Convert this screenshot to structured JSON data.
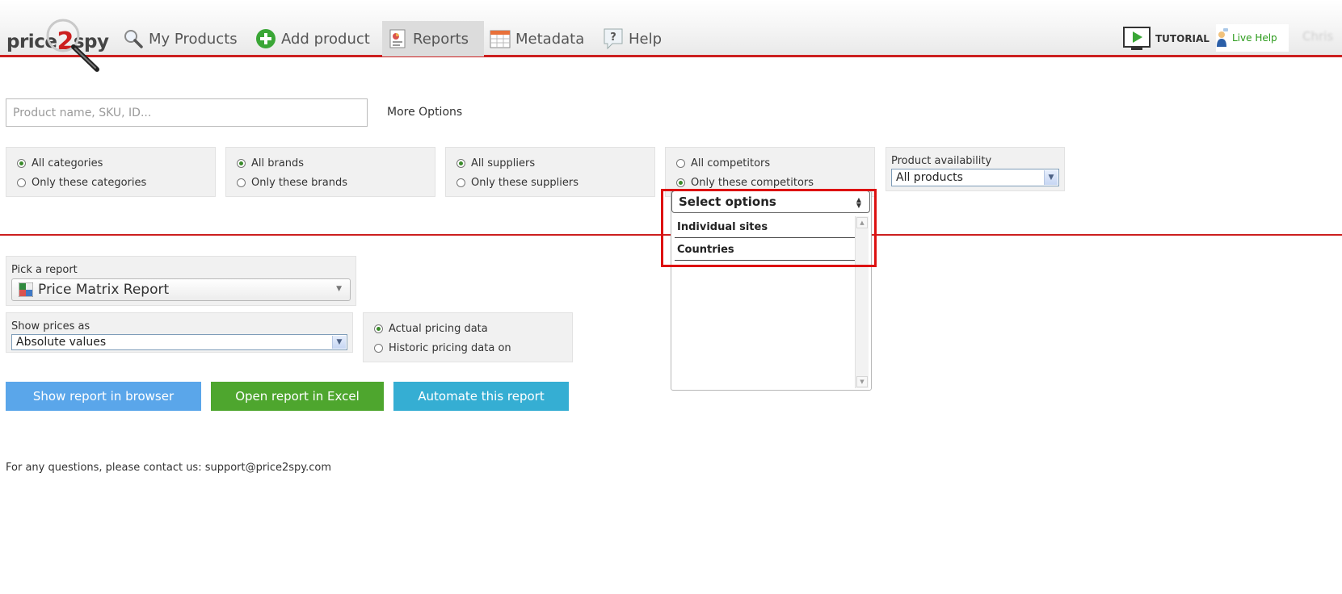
{
  "brand": {
    "logo_text_a": "price",
    "logo_text_b": "2",
    "logo_text_c": "spy",
    "accent": "#cc1f1f"
  },
  "nav": {
    "items": [
      {
        "label": "My Products",
        "icon": "magnifier-icon"
      },
      {
        "label": "Add product",
        "icon": "plus-circle-icon"
      },
      {
        "label": "Reports",
        "icon": "report-icon",
        "active": true
      },
      {
        "label": "Metadata",
        "icon": "calendar-table-icon"
      },
      {
        "label": "Help",
        "icon": "question-icon"
      }
    ],
    "tutorial_label": "TUTORIAL",
    "live_help_label": "Live Help",
    "user_name": "Chris"
  },
  "search": {
    "placeholder": "Product name, SKU, ID...",
    "value": "",
    "more_options": "More Options"
  },
  "filters": {
    "categories": {
      "all": "All categories",
      "only": "Only these categories",
      "selected": "all"
    },
    "brands": {
      "all": "All brands",
      "only": "Only these brands",
      "selected": "all"
    },
    "suppliers": {
      "all": "All suppliers",
      "only": "Only these suppliers",
      "selected": "all"
    },
    "competitors": {
      "all": "All competitors",
      "only": "Only these competitors",
      "selected": "only"
    },
    "availability": {
      "label": "Product availability",
      "value": "All products"
    }
  },
  "competitor_dropdown": {
    "placeholder": "Select options",
    "options": [
      "Individual sites",
      "Countries"
    ]
  },
  "report": {
    "pick_label": "Pick a report",
    "selected": "Price Matrix Report",
    "show_prices_label": "Show prices as",
    "show_prices_value": "Absolute values",
    "pricing_actual": "Actual pricing data",
    "pricing_historic": "Historic pricing data on",
    "pricing_selected": "actual"
  },
  "actions": {
    "show_browser": "Show report in browser",
    "open_excel": "Open report in Excel",
    "automate": "Automate this report"
  },
  "footer": {
    "contact": "For any questions, please contact us: support@price2spy.com"
  },
  "colors": {
    "blue_button": "#5aa6ea",
    "green_button": "#4ea62e",
    "teal_button": "#35aed3",
    "highlight": "#dd1111"
  }
}
